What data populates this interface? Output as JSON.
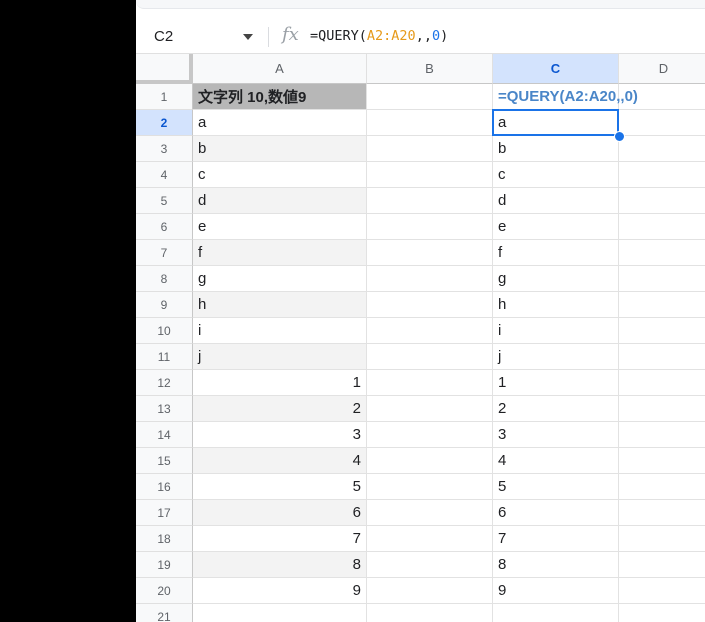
{
  "namebox": {
    "value": "C2"
  },
  "formula_bar": {
    "fx_label": "fx",
    "prefix": "=QUERY(",
    "range": "A2:A20",
    "sep": ",,",
    "number": "0",
    "suffix": ")"
  },
  "columns": [
    "A",
    "B",
    "C",
    "D"
  ],
  "active_column": "C",
  "active_cell": "C2",
  "rows": [
    {
      "n": "1",
      "a": "文字列 10,数値9",
      "b": "",
      "c": "=QUERY(A2:A20,,0)"
    },
    {
      "n": "2",
      "a": "a",
      "b": "",
      "c": "a"
    },
    {
      "n": "3",
      "a": "b",
      "b": "",
      "c": "b"
    },
    {
      "n": "4",
      "a": "c",
      "b": "",
      "c": "c"
    },
    {
      "n": "5",
      "a": "d",
      "b": "",
      "c": "d"
    },
    {
      "n": "6",
      "a": "e",
      "b": "",
      "c": "e"
    },
    {
      "n": "7",
      "a": "f",
      "b": "",
      "c": "f"
    },
    {
      "n": "8",
      "a": "g",
      "b": "",
      "c": "g"
    },
    {
      "n": "9",
      "a": "h",
      "b": "",
      "c": "h"
    },
    {
      "n": "10",
      "a": "i",
      "b": "",
      "c": "i"
    },
    {
      "n": "11",
      "a": "j",
      "b": "",
      "c": "j"
    },
    {
      "n": "12",
      "a": "1",
      "b": "",
      "c": "1"
    },
    {
      "n": "13",
      "a": "2",
      "b": "",
      "c": "2"
    },
    {
      "n": "14",
      "a": "3",
      "b": "",
      "c": "3"
    },
    {
      "n": "15",
      "a": "4",
      "b": "",
      "c": "4"
    },
    {
      "n": "16",
      "a": "5",
      "b": "",
      "c": "5"
    },
    {
      "n": "17",
      "a": "6",
      "b": "",
      "c": "6"
    },
    {
      "n": "18",
      "a": "7",
      "b": "",
      "c": "7"
    },
    {
      "n": "19",
      "a": "8",
      "b": "",
      "c": "8"
    },
    {
      "n": "20",
      "a": "9",
      "b": "",
      "c": "9"
    },
    {
      "n": "21",
      "a": "",
      "b": "",
      "c": ""
    }
  ],
  "colors": {
    "accent": "#1a73e8",
    "header_fill": "#b7b7b7",
    "alt_row_fill": "#f3f3f3",
    "formula_text": "#4a86c8",
    "range_ref": "#e69a1b"
  }
}
